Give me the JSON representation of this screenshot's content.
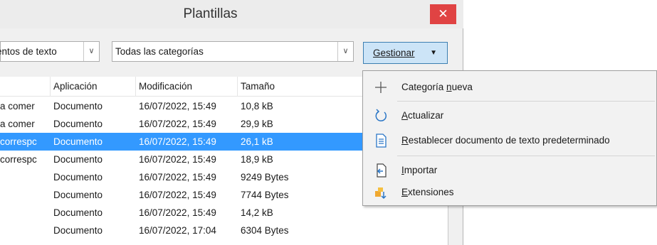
{
  "window": {
    "title": "Plantillas",
    "close_glyph": "✕"
  },
  "toolbar": {
    "filter_doc_type": "entos de texto",
    "filter_category": "Todas las categorías",
    "manage_label": "Gestionar",
    "manage_arrow": "▼",
    "dropdown_arrow": "∨"
  },
  "table": {
    "headers": [
      "Aplicación",
      "Modificación",
      "Tamaño"
    ],
    "rows": [
      {
        "name": "a comer",
        "app": "Documento",
        "modified": "16/07/2022, 15:49",
        "size": "10,8 kB",
        "selected": false
      },
      {
        "name": "a comer",
        "app": "Documento",
        "modified": "16/07/2022, 15:49",
        "size": "29,9 kB",
        "selected": false
      },
      {
        "name": "correspc",
        "app": "Documento",
        "modified": "16/07/2022, 15:49",
        "size": "26,1 kB",
        "selected": true
      },
      {
        "name": "correspc",
        "app": "Documento",
        "modified": "16/07/2022, 15:49",
        "size": "18,9 kB",
        "selected": false
      },
      {
        "name": "",
        "app": "Documento",
        "modified": "16/07/2022, 15:49",
        "size": "9249 Bytes",
        "selected": false
      },
      {
        "name": "",
        "app": "Documento",
        "modified": "16/07/2022, 15:49",
        "size": "7744 Bytes",
        "selected": false
      },
      {
        "name": "",
        "app": "Documento",
        "modified": "16/07/2022, 15:49",
        "size": "14,2 kB",
        "selected": false
      },
      {
        "name": "",
        "app": "Documento",
        "modified": "16/07/2022, 17:04",
        "size": "6304 Bytes",
        "selected": false
      }
    ]
  },
  "menu": {
    "new_category": {
      "pre": "Categoría ",
      "accel": "n",
      "post": "ueva",
      "icon": "plus-icon"
    },
    "refresh": {
      "pre": "",
      "accel": "A",
      "post": "ctualizar",
      "icon": "refresh-icon"
    },
    "reset_default": {
      "pre": "",
      "accel": "R",
      "post": "establecer documento de texto predeterminado",
      "icon": "document-icon"
    },
    "import": {
      "pre": "",
      "accel": "I",
      "post": "mportar",
      "icon": "import-icon"
    },
    "extensions": {
      "pre": "",
      "accel": "E",
      "post": "xtensiones",
      "icon": "extensions-icon"
    }
  },
  "colors": {
    "selection": "#3399ff",
    "close": "#e04343",
    "manage_bg": "#cce4f7"
  }
}
